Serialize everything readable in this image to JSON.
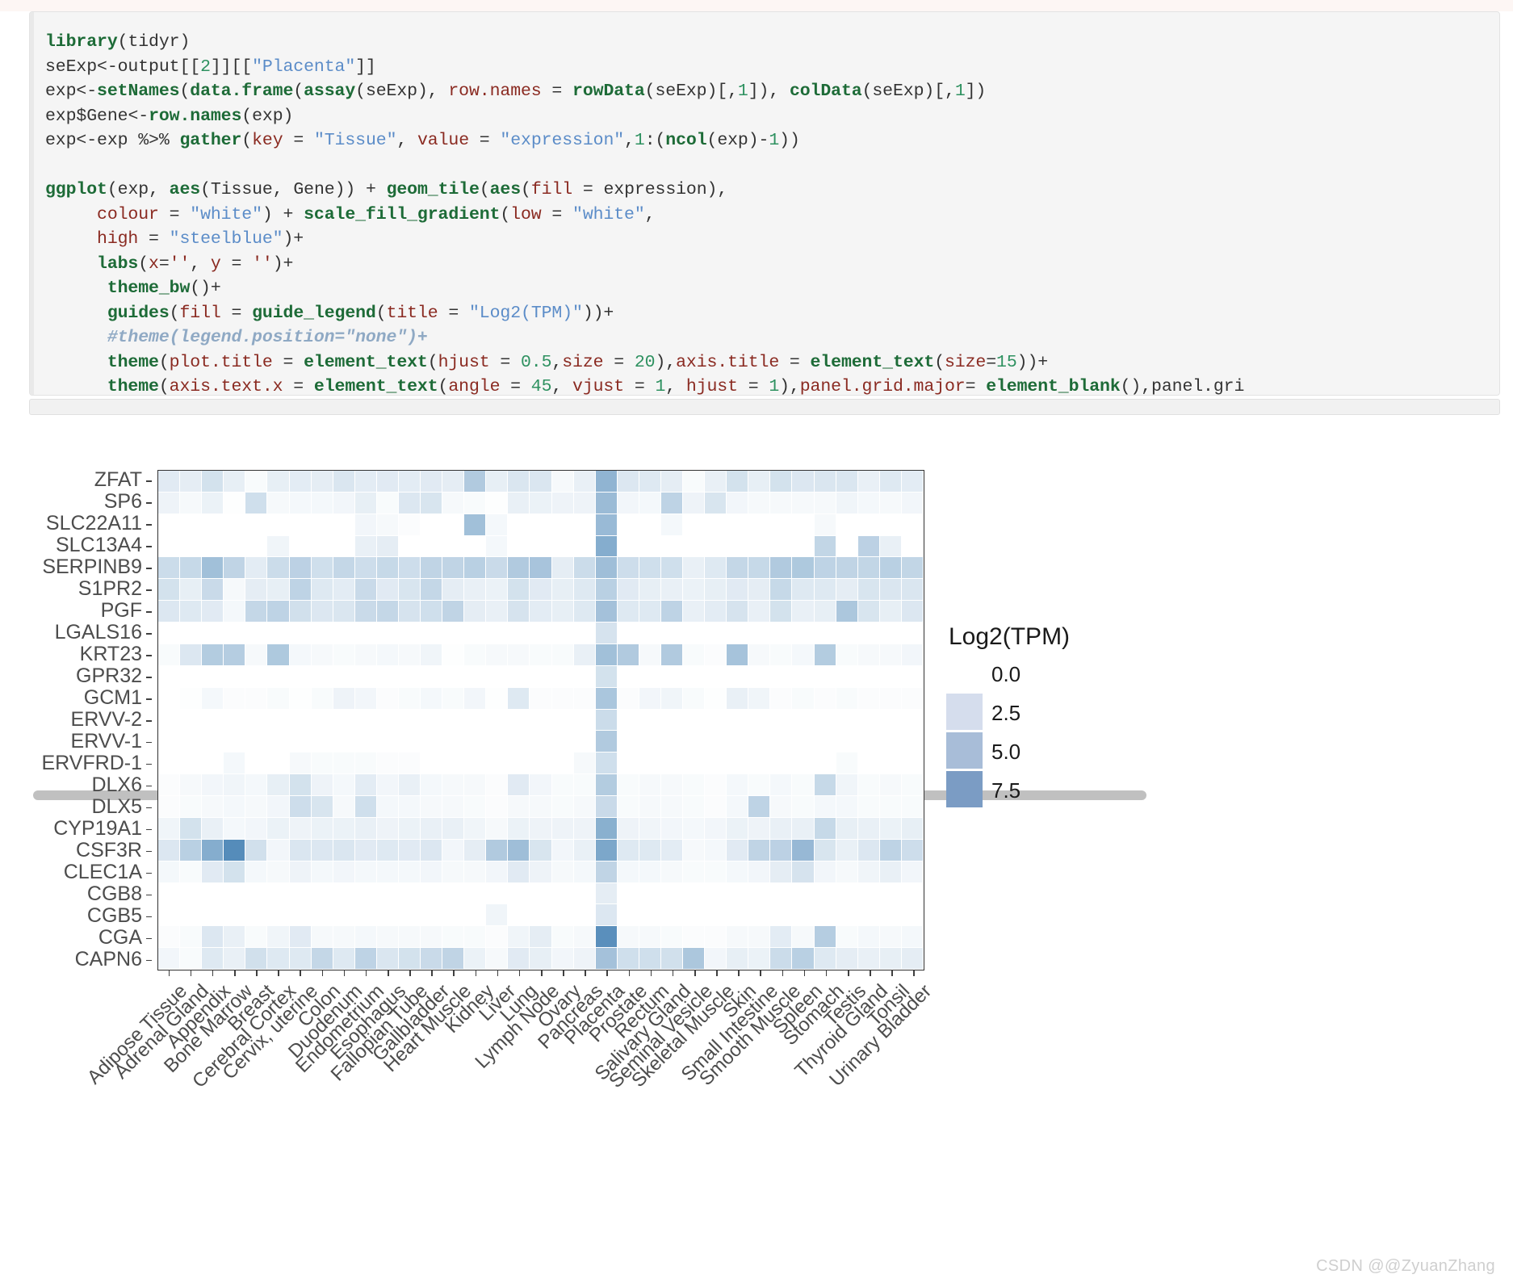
{
  "code": {
    "language": "R",
    "lines": [
      "library(tidyr)",
      "seExp<-output[[2]][[\"Placenta\"]]",
      "exp<-setNames(data.frame(assay(seExp), row.names = rowData(seExp)[,1]), colData(seExp)[,1])",
      "exp$Gene<-row.names(exp)",
      "exp<-exp %>% gather(key = \"Tissue\", value = \"expression\",1:(ncol(exp)-1))",
      "",
      "ggplot(exp, aes(Tissue, Gene)) + geom_tile(aes(fill = expression),",
      "     colour = \"white\") + scale_fill_gradient(low = \"white\",",
      "     high = \"steelblue\")+",
      "     labs(x='', y = '')+",
      "      theme_bw()+",
      "      guides(fill = guide_legend(title = \"Log2(TPM)\"))+",
      "      #theme(legend.position=\"none\")+",
      "      theme(plot.title = element_text(hjust = 0.5,size = 20),axis.title = element_text(size=15))+",
      "      theme(axis.text.x = element_text(angle = 45, vjust = 1, hjust = 1),panel.grid.major= element_blank(),panel.gri"
    ]
  },
  "scrollbar": {
    "thumb_fraction": 0.76
  },
  "legend": {
    "title": "Log2(TPM)",
    "labels": [
      "0.0",
      "2.5",
      "5.0",
      "7.5"
    ],
    "swatch_colors": [
      "#d5dded",
      "#a8bdd8",
      "#7b9cc4"
    ],
    "low_color": "#ffffff",
    "high_color": "#4682b4"
  },
  "watermark": "CSDN @@ZyuanZhang",
  "chart_data": {
    "type": "heatmap",
    "title": "",
    "xlabel": "",
    "ylabel": "",
    "grid": false,
    "legend_position": "right",
    "colorbar_label": "Log2(TPM)",
    "zlim": [
      0,
      8.5
    ],
    "low_color": "#ffffff",
    "high_color": "#4682b4",
    "x_categories": [
      "Adipose Tissue",
      "Adrenal Gland",
      "Appendix",
      "Bone Marrow",
      "Breast",
      "Cerebral Cortex",
      "Cervix, uterine",
      "Colon",
      "Duodenum",
      "Endometrium",
      "Esophagus",
      "Fallopian Tube",
      "Gallbladder",
      "Heart Muscle",
      "Kidney",
      "Liver",
      "Lung",
      "Lymph Node",
      "Ovary",
      "Pancreas",
      "Placenta",
      "Prostate",
      "Rectum",
      "Salivary Gland",
      "Seminal Vesicle",
      "Skeletal Muscle",
      "Skin",
      "Small Intestine",
      "Smooth Muscle",
      "Spleen",
      "Stomach",
      "Testis",
      "Thyroid Gland",
      "Tonsil",
      "Urinary Bladder"
    ],
    "y_categories": [
      "CAPN6",
      "CGA",
      "CGB5",
      "CGB8",
      "CLEC1A",
      "CSF3R",
      "CYP19A1",
      "DLX5",
      "DLX6",
      "ERVFRD-1",
      "ERVV-1",
      "ERVV-2",
      "GCM1",
      "GPR32",
      "KRT23",
      "LGALS16",
      "PGF",
      "S1PR2",
      "SERPINB9",
      "SLC13A4",
      "SLC22A11",
      "SP6"
    ],
    "y_display_order_top_to_bottom": [
      "ZFAT",
      "SP6",
      "SLC22A11",
      "SLC13A4",
      "SERPINB9",
      "S1PR2",
      "PGF",
      "LGALS16",
      "KRT23",
      "GPR32",
      "GCM1",
      "ERVV-2",
      "ERVV-1",
      "ERVFRD-1",
      "DLX6",
      "DLX5",
      "CYP19A1",
      "CSF3R",
      "CLEC1A",
      "CGB8",
      "CGB5",
      "CGA",
      "CAPN6"
    ],
    "values": [
      [
        1.4,
        1.2,
        2.0,
        1.1,
        0.3,
        1.1,
        1.3,
        1.2,
        1.7,
        1.3,
        1.4,
        1.3,
        1.4,
        1.2,
        3.6,
        1.1,
        1.7,
        1.7,
        0.4,
        1.0,
        5.1,
        1.6,
        1.5,
        1.2,
        0.3,
        1.0,
        2.0,
        1.1,
        2.0,
        1.6,
        1.7,
        1.7,
        1.0,
        1.5,
        1.3
      ],
      [
        0.8,
        0.4,
        0.9,
        0.1,
        2.2,
        0.4,
        0.5,
        0.5,
        0.6,
        1.1,
        0.3,
        1.6,
        1.8,
        0.4,
        0.3,
        0.1,
        1.0,
        0.9,
        0.8,
        0.8,
        4.6,
        0.6,
        0.5,
        3.0,
        0.8,
        1.8,
        0.6,
        0.4,
        0.4,
        0.4,
        0.4,
        0.7,
        0.5,
        0.4,
        0.6
      ],
      [
        0.0,
        0.0,
        0.0,
        0.0,
        0.0,
        0.0,
        0.0,
        0.0,
        0.0,
        0.6,
        0.4,
        0.2,
        0.0,
        0.0,
        4.3,
        0.5,
        0.0,
        0.0,
        0.0,
        0.0,
        4.7,
        0.0,
        0.0,
        0.5,
        0.0,
        0.0,
        0.0,
        0.0,
        0.0,
        0.0,
        0.4,
        0.0,
        0.0,
        0.0,
        0.0
      ],
      [
        0.0,
        0.0,
        0.0,
        0.0,
        0.0,
        0.7,
        0.0,
        0.0,
        0.0,
        1.0,
        1.2,
        0.0,
        0.0,
        0.0,
        0.0,
        0.5,
        0.0,
        0.0,
        0.0,
        0.0,
        5.6,
        0.0,
        0.0,
        0.0,
        0.0,
        0.0,
        0.0,
        0.0,
        0.0,
        0.0,
        2.8,
        0.0,
        3.1,
        1.0,
        0.0
      ],
      [
        2.4,
        2.6,
        4.3,
        2.9,
        1.3,
        2.4,
        3.1,
        2.2,
        2.7,
        2.3,
        2.6,
        2.3,
        2.9,
        2.9,
        3.2,
        2.5,
        3.6,
        4.0,
        1.2,
        2.4,
        4.4,
        2.3,
        2.2,
        2.2,
        1.0,
        1.5,
        2.7,
        2.6,
        3.6,
        3.7,
        3.0,
        2.9,
        2.8,
        3.2,
        2.8
      ],
      [
        2.0,
        1.1,
        2.5,
        0.4,
        1.2,
        1.1,
        3.0,
        1.5,
        1.3,
        2.5,
        1.4,
        1.8,
        2.7,
        1.2,
        1.0,
        0.9,
        2.0,
        1.4,
        1.1,
        1.5,
        3.2,
        1.4,
        1.1,
        1.0,
        0.9,
        1.1,
        1.4,
        1.2,
        2.6,
        1.5,
        1.5,
        1.2,
        1.8,
        1.7,
        1.7
      ],
      [
        1.6,
        1.5,
        1.4,
        0.5,
        2.7,
        3.0,
        2.1,
        1.6,
        1.7,
        2.5,
        2.7,
        1.9,
        2.2,
        2.9,
        1.2,
        1.0,
        1.9,
        1.3,
        1.1,
        1.5,
        4.2,
        1.5,
        1.5,
        3.0,
        1.0,
        1.3,
        1.9,
        1.0,
        2.0,
        1.0,
        1.1,
        3.8,
        1.8,
        1.1,
        1.6
      ],
      [
        0.0,
        0.0,
        0.0,
        0.0,
        0.0,
        0.0,
        0.0,
        0.0,
        0.0,
        0.0,
        0.0,
        0.0,
        0.0,
        0.0,
        0.0,
        0.0,
        0.0,
        0.0,
        0.0,
        0.0,
        1.9,
        0.0,
        0.0,
        0.0,
        0.0,
        0.0,
        0.0,
        0.0,
        0.0,
        0.0,
        0.0,
        0.0,
        0.0,
        0.0,
        0.0
      ],
      [
        0.3,
        1.6,
        3.5,
        3.4,
        0.4,
        3.7,
        0.5,
        0.4,
        0.3,
        0.4,
        0.5,
        0.4,
        0.7,
        0.1,
        0.3,
        0.4,
        0.4,
        0.3,
        0.3,
        1.0,
        4.3,
        3.6,
        0.4,
        3.6,
        0.3,
        0.2,
        4.1,
        0.4,
        0.3,
        0.5,
        3.5,
        0.3,
        0.4,
        0.4,
        0.6
      ],
      [
        0.0,
        0.0,
        0.0,
        0.0,
        0.0,
        0.0,
        0.0,
        0.0,
        0.0,
        0.0,
        0.0,
        0.0,
        0.0,
        0.0,
        0.0,
        0.0,
        0.0,
        0.0,
        0.0,
        0.0,
        2.0,
        0.0,
        0.0,
        0.0,
        0.0,
        0.0,
        0.0,
        0.0,
        0.0,
        0.0,
        0.0,
        0.0,
        0.0,
        0.0,
        0.0
      ],
      [
        0.0,
        0.1,
        0.5,
        0.2,
        0.2,
        0.3,
        0.1,
        0.3,
        0.8,
        0.6,
        0.2,
        0.3,
        0.5,
        0.3,
        0.6,
        0.1,
        1.5,
        0.2,
        0.2,
        0.2,
        3.9,
        0.2,
        0.6,
        0.7,
        0.3,
        0.1,
        1.0,
        0.7,
        0.2,
        0.3,
        0.2,
        0.3,
        0.2,
        0.2,
        0.2
      ],
      [
        0.0,
        0.0,
        0.0,
        0.0,
        0.0,
        0.0,
        0.0,
        0.0,
        0.0,
        0.0,
        0.0,
        0.0,
        0.0,
        0.0,
        0.0,
        0.0,
        0.0,
        0.0,
        0.0,
        0.0,
        2.4,
        0.0,
        0.0,
        0.0,
        0.0,
        0.0,
        0.0,
        0.0,
        0.0,
        0.0,
        0.0,
        0.0,
        0.0,
        0.0,
        0.0
      ],
      [
        0.0,
        0.0,
        0.0,
        0.0,
        0.0,
        0.0,
        0.0,
        0.0,
        0.0,
        0.0,
        0.0,
        0.0,
        0.0,
        0.0,
        0.0,
        0.0,
        0.0,
        0.0,
        0.0,
        0.0,
        3.6,
        0.0,
        0.0,
        0.0,
        0.0,
        0.0,
        0.0,
        0.0,
        0.0,
        0.0,
        0.0,
        0.0,
        0.0,
        0.0,
        0.0
      ],
      [
        0.0,
        0.0,
        0.0,
        0.5,
        0.0,
        0.0,
        0.4,
        0.3,
        0.3,
        0.3,
        0.2,
        0.2,
        0.0,
        0.0,
        0.0,
        0.0,
        0.0,
        0.0,
        0.0,
        0.4,
        2.2,
        0.0,
        0.0,
        0.0,
        0.0,
        0.0,
        0.0,
        0.0,
        0.0,
        0.0,
        0.0,
        0.3,
        0.0,
        0.0,
        0.0
      ],
      [
        0.2,
        0.4,
        0.6,
        0.7,
        0.5,
        1.1,
        2.0,
        0.8,
        0.5,
        1.3,
        0.6,
        1.0,
        0.5,
        0.4,
        0.4,
        0.2,
        1.4,
        0.6,
        0.3,
        0.3,
        3.5,
        0.3,
        0.4,
        0.4,
        0.3,
        0.2,
        0.5,
        0.3,
        0.5,
        0.3,
        2.6,
        0.7,
        0.3,
        0.4,
        0.3
      ],
      [
        0.2,
        0.3,
        0.4,
        0.5,
        0.4,
        0.6,
        2.3,
        1.8,
        0.4,
        2.2,
        0.5,
        0.5,
        0.4,
        0.4,
        0.3,
        0.2,
        0.4,
        0.4,
        0.3,
        0.4,
        2.5,
        0.3,
        0.4,
        0.4,
        0.3,
        0.2,
        0.5,
        3.0,
        0.4,
        0.3,
        0.5,
        0.5,
        0.3,
        0.3,
        0.3
      ],
      [
        0.7,
        2.0,
        1.0,
        0.5,
        0.6,
        0.9,
        0.8,
        0.9,
        0.9,
        1.0,
        0.8,
        0.9,
        1.0,
        1.0,
        0.7,
        0.4,
        0.9,
        0.8,
        0.8,
        0.8,
        5.4,
        0.8,
        0.7,
        0.6,
        0.5,
        0.6,
        0.9,
        0.8,
        1.0,
        1.0,
        2.6,
        1.1,
        1.0,
        0.9,
        1.1
      ],
      [
        1.6,
        3.2,
        5.6,
        7.8,
        2.1,
        0.6,
        1.7,
        1.6,
        1.7,
        1.4,
        1.5,
        1.4,
        1.6,
        0.6,
        1.2,
        3.6,
        4.4,
        1.8,
        0.6,
        1.0,
        6.0,
        1.5,
        1.5,
        1.3,
        0.4,
        0.5,
        1.4,
        2.9,
        3.1,
        4.8,
        1.8,
        1.0,
        1.6,
        3.0,
        2.3
      ],
      [
        0.5,
        0.3,
        1.4,
        2.0,
        0.5,
        0.4,
        0.8,
        0.5,
        0.6,
        0.5,
        0.5,
        0.5,
        0.6,
        0.4,
        0.4,
        0.6,
        1.4,
        0.8,
        0.4,
        0.5,
        2.9,
        0.5,
        0.5,
        0.4,
        0.3,
        0.3,
        0.5,
        0.6,
        1.2,
        1.9,
        0.6,
        0.4,
        0.7,
        1.0,
        0.6
      ],
      [
        0.0,
        0.0,
        0.0,
        0.0,
        0.0,
        0.0,
        0.0,
        0.0,
        0.0,
        0.0,
        0.0,
        0.0,
        0.0,
        0.0,
        0.0,
        0.0,
        0.0,
        0.0,
        0.0,
        0.0,
        1.2,
        0.0,
        0.0,
        0.0,
        0.0,
        0.0,
        0.0,
        0.0,
        0.0,
        0.0,
        0.0,
        0.0,
        0.0,
        0.0,
        0.0
      ],
      [
        0.0,
        0.0,
        0.0,
        0.0,
        0.0,
        0.0,
        0.0,
        0.0,
        0.0,
        0.0,
        0.0,
        0.0,
        0.0,
        0.0,
        0.0,
        0.7,
        0.0,
        0.0,
        0.0,
        0.0,
        1.6,
        0.0,
        0.0,
        0.0,
        0.0,
        0.0,
        0.0,
        0.0,
        0.0,
        0.0,
        0.0,
        0.0,
        0.0,
        0.0,
        0.0
      ],
      [
        0.2,
        0.3,
        1.6,
        1.0,
        0.3,
        0.7,
        1.4,
        0.4,
        0.4,
        0.5,
        0.4,
        0.4,
        0.4,
        0.3,
        0.3,
        0.2,
        0.7,
        1.2,
        0.3,
        0.4,
        7.6,
        0.4,
        0.4,
        0.3,
        0.2,
        0.2,
        0.4,
        0.4,
        1.3,
        0.4,
        3.4,
        0.3,
        0.5,
        0.4,
        0.5
      ],
      [
        0.6,
        0.3,
        1.5,
        1.0,
        2.1,
        1.5,
        1.5,
        2.7,
        1.5,
        3.0,
        1.7,
        2.0,
        2.5,
        2.9,
        0.9,
        0.4,
        1.4,
        1.1,
        0.6,
        0.8,
        4.2,
        2.2,
        2.2,
        2.1,
        3.8,
        0.6,
        1.1,
        0.9,
        2.4,
        3.2,
        1.5,
        1.2,
        1.0,
        1.1,
        1.2
      ]
    ]
  }
}
